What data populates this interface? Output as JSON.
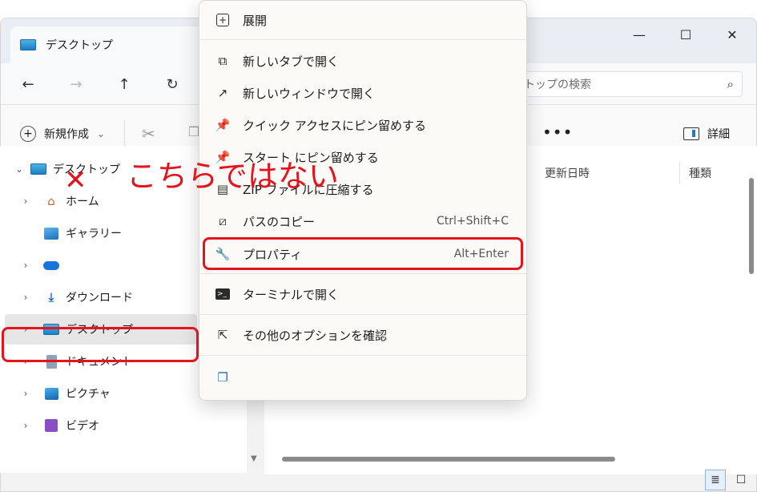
{
  "window": {
    "tab_title": "デスクトップ",
    "maximize": "☐",
    "close": "✕",
    "minimize": "—"
  },
  "address": {
    "back": "←",
    "forward": "→",
    "up": "↑",
    "refresh": "↻",
    "search_placeholder": "トップの検索"
  },
  "toolbar": {
    "new_label": "新規作成",
    "new_caret": "⌄",
    "more": "•••",
    "details_label": "詳細"
  },
  "nav": {
    "items": [
      {
        "label": "デスクトップ",
        "chev": "⌄"
      },
      {
        "label": "ホーム",
        "chev": "›"
      },
      {
        "label": "ギャラリー",
        "chev": ""
      },
      {
        "label": "",
        "chev": "›"
      },
      {
        "label": "ダウンロード",
        "chev": "›"
      },
      {
        "label": "デスクトップ",
        "chev": "›"
      },
      {
        "label": "ドキュメント",
        "chev": "›"
      },
      {
        "label": "ピクチャ",
        "chev": "›"
      },
      {
        "label": "ビデオ",
        "chev": "›"
      }
    ]
  },
  "content": {
    "col_modified": "更新日時",
    "col_type": "種類"
  },
  "menu": {
    "items": [
      {
        "label": "展開",
        "shortcut": ""
      },
      {
        "label": "新しいタブで開く",
        "shortcut": ""
      },
      {
        "label": "新しいウィンドウで開く",
        "shortcut": ""
      },
      {
        "label": "クイック アクセスにピン留めする",
        "shortcut": ""
      },
      {
        "label": "スタート にピン留めする",
        "shortcut": ""
      },
      {
        "label": "ZIP ファイルに圧縮する",
        "shortcut": ""
      },
      {
        "label": "パスのコピー",
        "shortcut": "Ctrl+Shift+C"
      },
      {
        "label": "プロパティ",
        "shortcut": "Alt+Enter"
      },
      {
        "label": "ターミナルで開く",
        "shortcut": ""
      },
      {
        "label": "その他のオプションを確認",
        "shortcut": ""
      }
    ]
  },
  "annotation": {
    "note": "こちらではない",
    "x_mark": "✕",
    "color": "#e3141b"
  }
}
